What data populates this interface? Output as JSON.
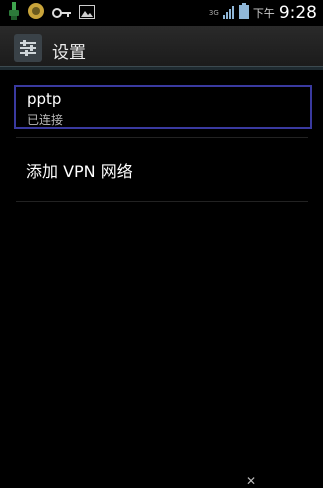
{
  "status_bar": {
    "icons": [
      "usb-icon",
      "sync-icon",
      "vpn-key-icon",
      "image-icon"
    ],
    "network_label": "3G",
    "time_prefix": "下午",
    "time": "9:28"
  },
  "action_bar": {
    "icon": "settings-icon",
    "title": "设置"
  },
  "vpn_list": [
    {
      "name": "pptp",
      "status": "已连接"
    }
  ],
  "add_vpn_label": "添加 VPN 网络"
}
